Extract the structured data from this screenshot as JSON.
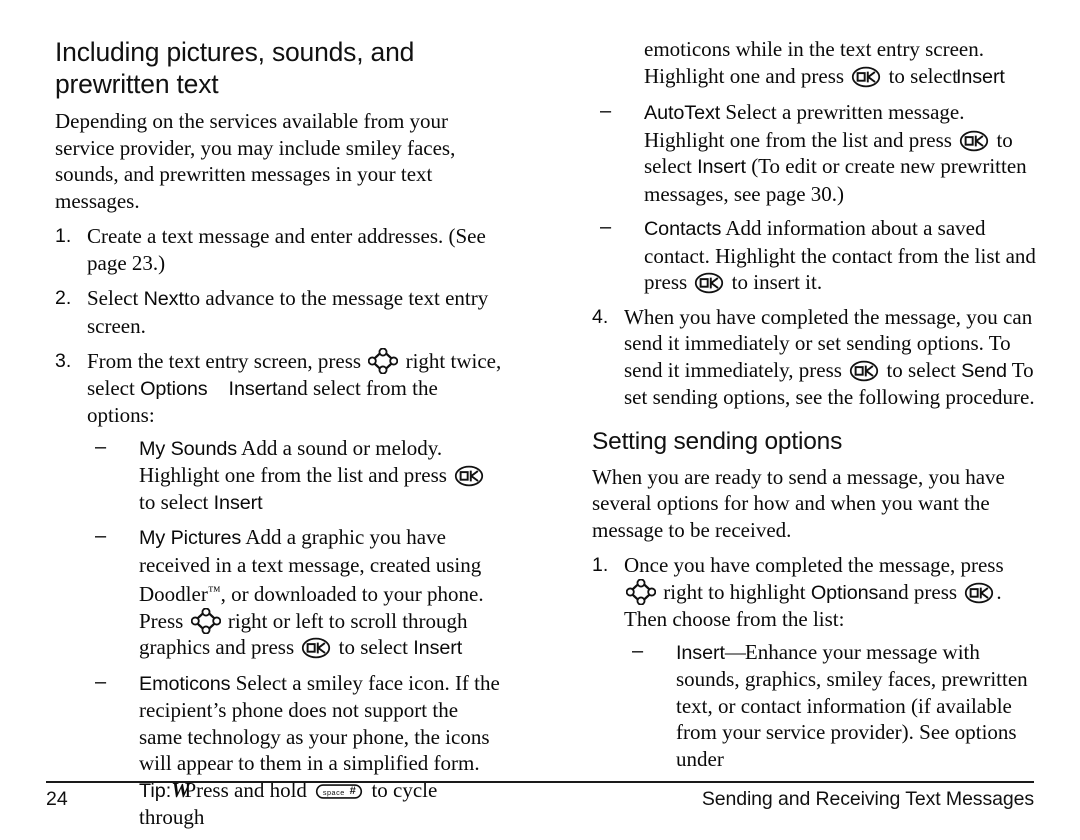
{
  "document": {
    "page_number": "24",
    "footer_title": "Sending and Receiving Text Messages"
  },
  "left_column": {
    "heading": "Including pictures, sounds, and prewritten text",
    "intro": "Depending on the services available from your service provider, you may include smiley faces, sounds, and prewritten messages in your text messages.",
    "steps": [
      {
        "number": "1.",
        "text_1": "Create a text message and enter addresses. (See page 23.)"
      },
      {
        "number": "2.",
        "text_1": "Select ",
        "ui_1": "Next",
        "text_2": "to advance to the message text entry screen."
      },
      {
        "number": "3.",
        "text_1": "From the text entry screen, press ",
        "icon_1": "nav-key-icon",
        "text_2": " right twice, select ",
        "ui_1": "Options",
        "gap": "    ",
        "ui_2": "Insert",
        "text_3": "and select from the options:"
      }
    ],
    "options": [
      {
        "dash": "–",
        "ui_1": "My Sounds",
        "text_1": " Add a sound or melody. Highlight one from the list and press ",
        "icon_1": "ok-key-icon",
        "text_2": " to select ",
        "ui_2": "Insert"
      },
      {
        "dash": "–",
        "ui_1": "My Pictures",
        "text_1": " Add a graphic you have received in a text message, created using Doodler",
        "tm": "™",
        "text_2": ", or downloaded to your phone. Press ",
        "icon_1": "nav-key-icon",
        "text_3": " right or left to scroll through graphics and press ",
        "icon_2": "ok-key-icon",
        "text_4": " to select ",
        "ui_2": "Insert"
      },
      {
        "dash": "–",
        "ui_1": "Emoticons",
        "text_1": " Select a smiley face icon. If the recipient’s phone does not support the same technology as your phone, the icons will appear to them in a simplified form.",
        "tip_label": "Tip:",
        "tip_word": "W",
        "tip_text_1": "Press and hold ",
        "icon_1": "space-key-icon",
        "tip_text_2": " to cycle through"
      }
    ]
  },
  "right_column": {
    "continuation": {
      "text_1": "emoticons while in the text entry screen. Highlight one and press ",
      "icon_1": "ok-key-icon",
      "text_2": " to select",
      "ui_1": "Insert"
    },
    "options": [
      {
        "dash": "–",
        "ui_1": "AutoText",
        "text_1": " Select a prewritten message. Highlight one from the list and press ",
        "icon_1": "ok-key-icon",
        "text_2": " to select ",
        "ui_2": "Insert",
        "text_3": " (To edit or create new prewritten messages, see page 30.)"
      },
      {
        "dash": "–",
        "ui_1": "Contacts",
        "text_1": " Add information about a saved contact. Highlight the contact from the list and press ",
        "icon_1": "ok-key-icon",
        "text_2": " to insert it."
      }
    ],
    "step_4": {
      "number": "4.",
      "text_1": "When you have completed the message, you can send it immediately or set sending options. To send it immediately, press ",
      "icon_1": "ok-key-icon",
      "text_2": " to select ",
      "ui_1": "Send",
      "text_3": " To set sending options, see the following procedure."
    },
    "heading": "Setting sending options",
    "intro": "When you are ready to send a message, you have several options for how and when you want the message to be received.",
    "step_1": {
      "number": "1.",
      "text_1": "Once you have completed the message, press ",
      "icon_1": "nav-key-icon",
      "text_2": " right to highlight ",
      "ui_1": "Options",
      "text_3": "and press ",
      "icon_2": "ok-key-icon",
      "text_4": ". Then choose from the list:"
    },
    "sub_options": [
      {
        "dash": "–",
        "ui_1": "Insert",
        "emdash": "—",
        "text_1": "Enhance your message with sounds, graphics, smiley faces, prewritten text, or contact information (if available from your service provider). See options under"
      }
    ]
  },
  "icons": {
    "nav_key": "nav-key-icon",
    "ok_key": "ok-key-icon",
    "ok_key_label": "OK",
    "space_key": "space-key-icon",
    "space_key_label": "space",
    "space_key_symbol": "#"
  },
  "colors": {
    "text": "#0a0a0a",
    "rule": "#1a1a1a",
    "background": "#ffffff"
  }
}
